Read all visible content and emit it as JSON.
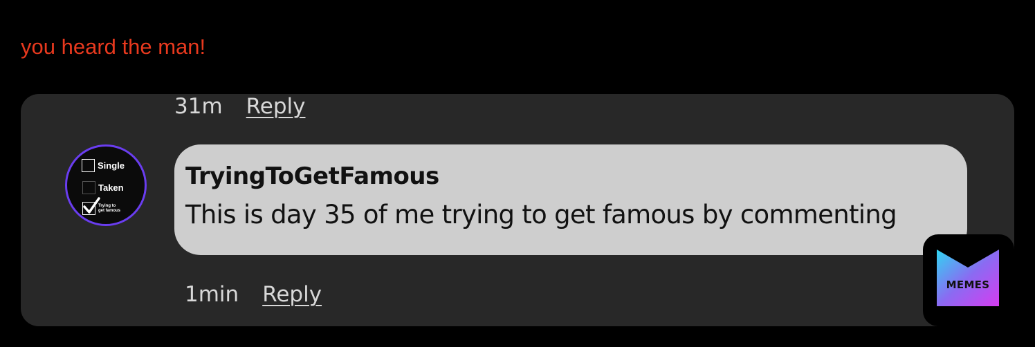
{
  "caption": "you heard the man!",
  "thread": {
    "previous": {
      "time": "31m",
      "reply_label": "Reply"
    },
    "comment": {
      "username": "TryingToGetFamous",
      "text": "This is day 35 of me trying to get famous by commenting",
      "time": "1min",
      "reply_label": "Reply"
    },
    "avatar": {
      "options": [
        "Single",
        "Taken",
        "Trying to",
        "get famous"
      ],
      "checked": "Trying to get famous"
    }
  },
  "badge": {
    "label": "MEMES",
    "icon": "memes-logo-icon"
  },
  "colors": {
    "caption": "#e8391e",
    "panel": "#282828",
    "bubble": "#cecece",
    "avatar_ring": "#6a3df0"
  }
}
